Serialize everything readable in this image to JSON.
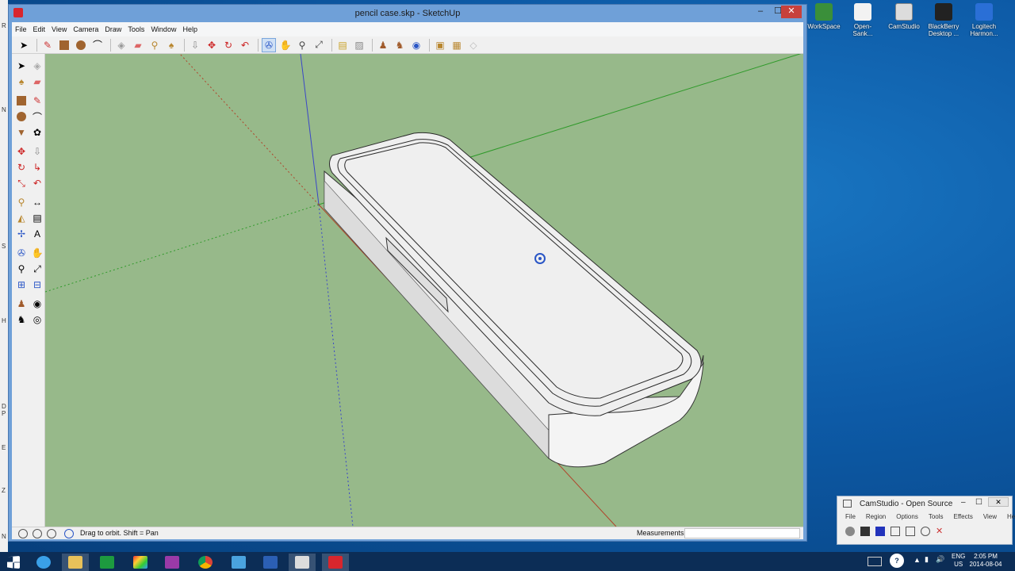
{
  "window": {
    "title": "pencil case.skp - SketchUp",
    "minimize": "–",
    "maximize": "☐",
    "close": "✕"
  },
  "menu": [
    "File",
    "Edit",
    "View",
    "Camera",
    "Draw",
    "Tools",
    "Window",
    "Help"
  ],
  "statusbar": {
    "hint": "Drag to orbit.  Shift = Pan",
    "measurements_label": "Measurements",
    "measurements_value": ""
  },
  "desktop_icons": [
    {
      "label": "WorkSpace",
      "icon": "workspace-icon",
      "color": "#3a8f3a"
    },
    {
      "label": "Open-Sank...",
      "icon": "open-sankore-icon",
      "color": "#ffffff"
    },
    {
      "label": "CamStudio",
      "icon": "camstudio-icon",
      "color": "#e8e8e8"
    },
    {
      "label": "BlackBerry Desktop ...",
      "icon": "blackberry-icon",
      "color": "#222222"
    },
    {
      "label": "Logitech Harmon...",
      "icon": "logitech-harmony-icon",
      "color": "#2a6fd6"
    }
  ],
  "camstudio": {
    "title": "CamStudio - Open Source",
    "menu": [
      "File",
      "Region",
      "Options",
      "Tools",
      "Effects",
      "View",
      "Help"
    ],
    "close": "✕",
    "minimize": "–",
    "maximize": "☐"
  },
  "behind_window_letters": [
    "R",
    "N",
    "S",
    "H",
    "D",
    "P",
    "E",
    "Z",
    "N"
  ],
  "taskbar": {
    "tray_lang": "ENG",
    "tray_region": "US",
    "time": "2:05 PM",
    "date": "2014-08-04",
    "tray_up": "▲",
    "tray_speaker": "🔊",
    "tray_network": "▮",
    "tray_help": "?"
  },
  "colors": {
    "viewport": "#97b98a",
    "red_axis": "#b0442b",
    "green_axis": "#2f9a2a",
    "blue_axis": "#3a46c8"
  }
}
